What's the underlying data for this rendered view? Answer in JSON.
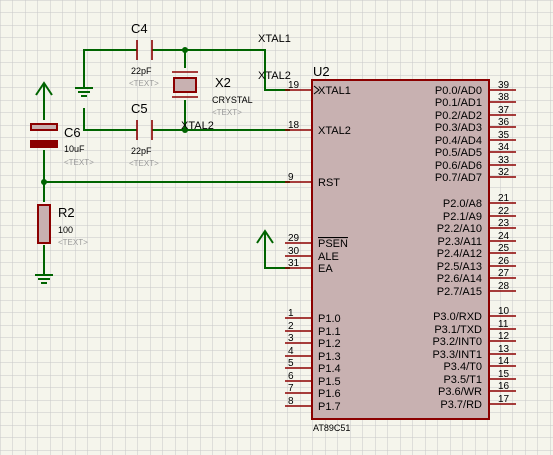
{
  "net_labels": {
    "xtal1": "XTAL1",
    "xtal2_top": "XTAL2",
    "xtal2_bot": "XTAL2"
  },
  "u2": {
    "ref": "U2",
    "part": "AT89C51",
    "left_pins": [
      {
        "num": "19",
        "name": "XTAL1"
      },
      {
        "num": "18",
        "name": "XTAL2"
      },
      {
        "num": "9",
        "name": "RST"
      },
      {
        "num": "29",
        "name": "PSEN"
      },
      {
        "num": "30",
        "name": "ALE"
      },
      {
        "num": "31",
        "name": "EA"
      },
      {
        "num": "1",
        "name": "P1.0"
      },
      {
        "num": "2",
        "name": "P1.1"
      },
      {
        "num": "3",
        "name": "P1.2"
      },
      {
        "num": "4",
        "name": "P1.3"
      },
      {
        "num": "5",
        "name": "P1.4"
      },
      {
        "num": "6",
        "name": "P1.5"
      },
      {
        "num": "7",
        "name": "P1.6"
      },
      {
        "num": "8",
        "name": "P1.7"
      }
    ],
    "right_pins": [
      {
        "num": "39",
        "name": "P0.0/AD0"
      },
      {
        "num": "38",
        "name": "P0.1/AD1"
      },
      {
        "num": "37",
        "name": "P0.2/AD2"
      },
      {
        "num": "36",
        "name": "P0.3/AD3"
      },
      {
        "num": "35",
        "name": "P0.4/AD4"
      },
      {
        "num": "34",
        "name": "P0.5/AD5"
      },
      {
        "num": "33",
        "name": "P0.6/AD6"
      },
      {
        "num": "32",
        "name": "P0.7/AD7"
      },
      {
        "num": "21",
        "name": "P2.0/A8"
      },
      {
        "num": "22",
        "name": "P2.1/A9"
      },
      {
        "num": "23",
        "name": "P2.2/A10"
      },
      {
        "num": "24",
        "name": "P2.3/A11"
      },
      {
        "num": "25",
        "name": "P2.4/A12"
      },
      {
        "num": "26",
        "name": "P2.5/A13"
      },
      {
        "num": "27",
        "name": "P2.6/A14"
      },
      {
        "num": "28",
        "name": "P2.7/A15"
      },
      {
        "num": "10",
        "name": "P3.0/RXD"
      },
      {
        "num": "11",
        "name": "P3.1/TXD"
      },
      {
        "num": "12",
        "name": "P3.2/INT0"
      },
      {
        "num": "13",
        "name": "P3.3/INT1"
      },
      {
        "num": "14",
        "name": "P3.4/T0"
      },
      {
        "num": "15",
        "name": "P3.5/T1"
      },
      {
        "num": "16",
        "name": "P3.6/WR"
      },
      {
        "num": "17",
        "name": "P3.7/RD"
      }
    ]
  },
  "components": {
    "c4": {
      "ref": "C4",
      "value": "22pF",
      "text": "<TEXT>"
    },
    "c5": {
      "ref": "C5",
      "value": "22pF",
      "text": "<TEXT>"
    },
    "x2": {
      "ref": "X2",
      "value": "CRYSTAL",
      "text": "<TEXT>"
    },
    "c6": {
      "ref": "C6",
      "value": "10uF",
      "text": "<TEXT>"
    },
    "r2": {
      "ref": "R2",
      "value": "100",
      "text": "<TEXT>"
    }
  },
  "colors": {
    "wire": "#006400",
    "component": "#8b0000",
    "fill": "#c8b1b1",
    "grid": "#c8c8c8",
    "background": "#f5f5ec"
  }
}
